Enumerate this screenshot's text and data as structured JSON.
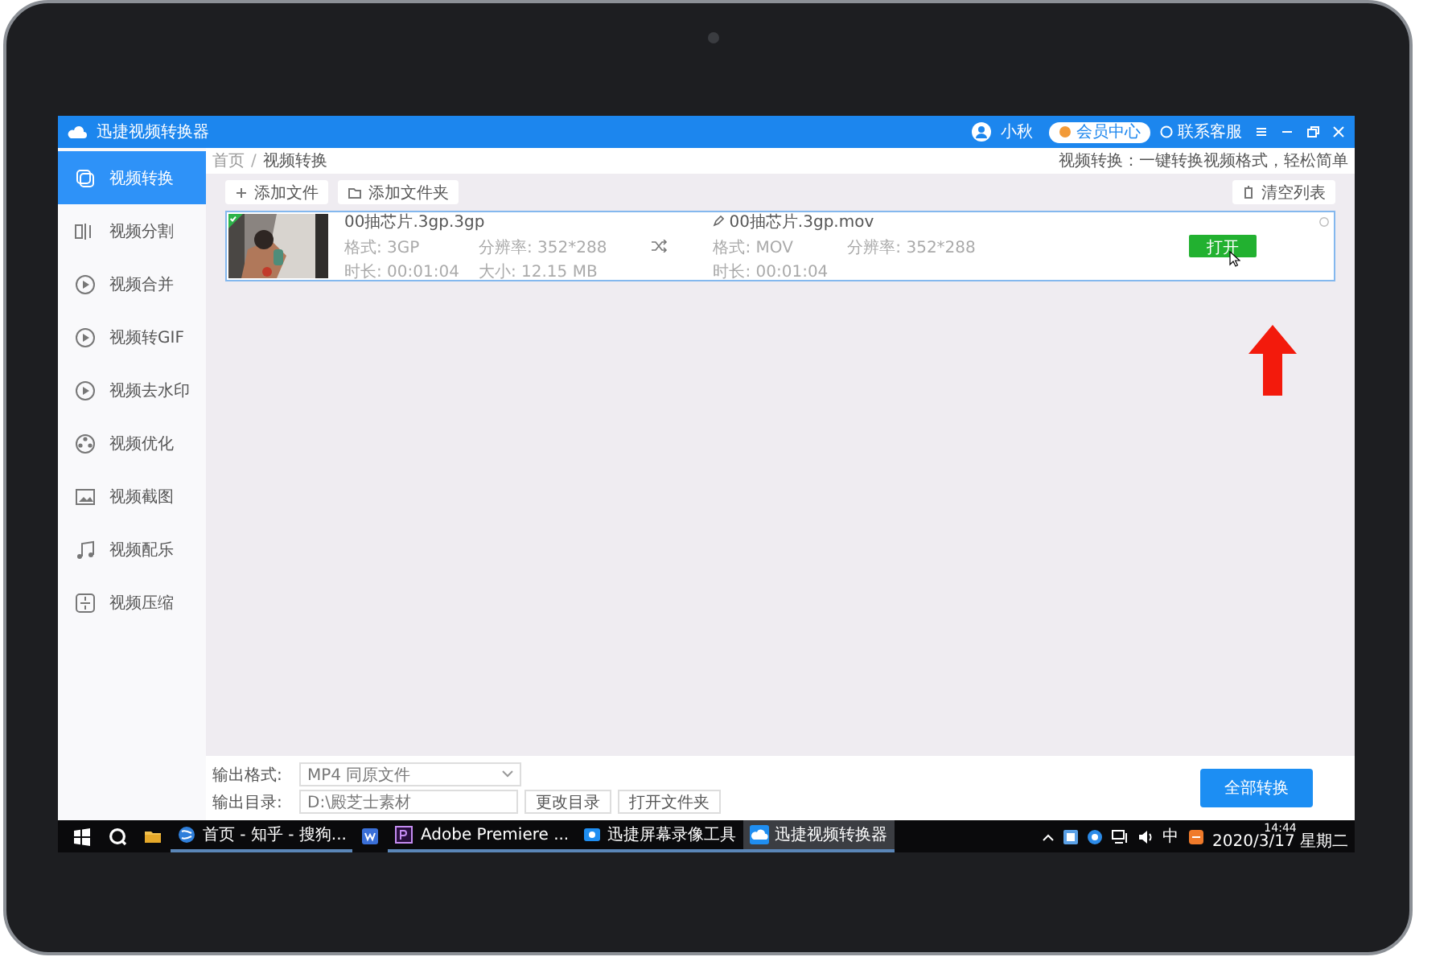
{
  "window": {
    "title": "迅捷视频转换器"
  },
  "header": {
    "user": "小秋",
    "vip": "会员中心",
    "support": "联系客服"
  },
  "sidebar": {
    "items": [
      {
        "label": "视频转换",
        "selected": true
      },
      {
        "label": "视频分割",
        "selected": false
      },
      {
        "label": "视频合并",
        "selected": false
      },
      {
        "label": "视频转GIF",
        "selected": false
      },
      {
        "label": "视频去水印",
        "selected": false
      },
      {
        "label": "视频优化",
        "selected": false
      },
      {
        "label": "视频截图",
        "selected": false
      },
      {
        "label": "视频配乐",
        "selected": false
      },
      {
        "label": "视频压缩",
        "selected": false
      }
    ]
  },
  "breadcrumb": {
    "items": [
      "首页",
      "视频转换"
    ],
    "separator": "/"
  },
  "tagline": "视频转换：一键转换视频格式，轻松简单",
  "toolbar": {
    "add_file": "添加文件",
    "add_folder": "添加文件夹",
    "clear": "清空列表"
  },
  "files": [
    {
      "checked": true,
      "source": {
        "name": "00抽芯片.3gp.3gp",
        "format": "格式: 3GP",
        "resolution": "分辨率: 352*288",
        "duration": "时长: 00:01:04",
        "size": "大小: 12.15 MB"
      },
      "output": {
        "name": "00抽芯片.3gp.mov",
        "format": "格式: MOV",
        "resolution": "分辨率: 352*288",
        "duration": "时长: 00:01:04"
      },
      "action": "打开"
    }
  ],
  "output": {
    "format_label": "输出格式:",
    "format": "MP4  同原文件",
    "dir_label": "输出目录:",
    "dir": "D:\\殿芝士素材",
    "change_dir": "更改目录",
    "open_folder": "打开文件夹",
    "convert_all": "全部转换"
  },
  "taskbar": {
    "items": [
      {
        "kind": "start",
        "selected": false
      },
      {
        "kind": "search",
        "selected": false
      },
      {
        "kind": "folder",
        "selected": false
      },
      {
        "kind": "browser",
        "label": "首页 - 知乎 - 搜狗...",
        "selected": false
      },
      {
        "kind": "writer",
        "selected": false
      },
      {
        "kind": "premiere",
        "label": "Adobe Premiere ...",
        "selected": false
      },
      {
        "kind": "recorder",
        "label": "迅捷屏幕录像工具",
        "selected": false
      },
      {
        "kind": "converter",
        "label": "迅捷视频转换器",
        "selected": true
      }
    ],
    "ime": "中",
    "time": "14:44",
    "date": "2020/3/17 星期二"
  }
}
